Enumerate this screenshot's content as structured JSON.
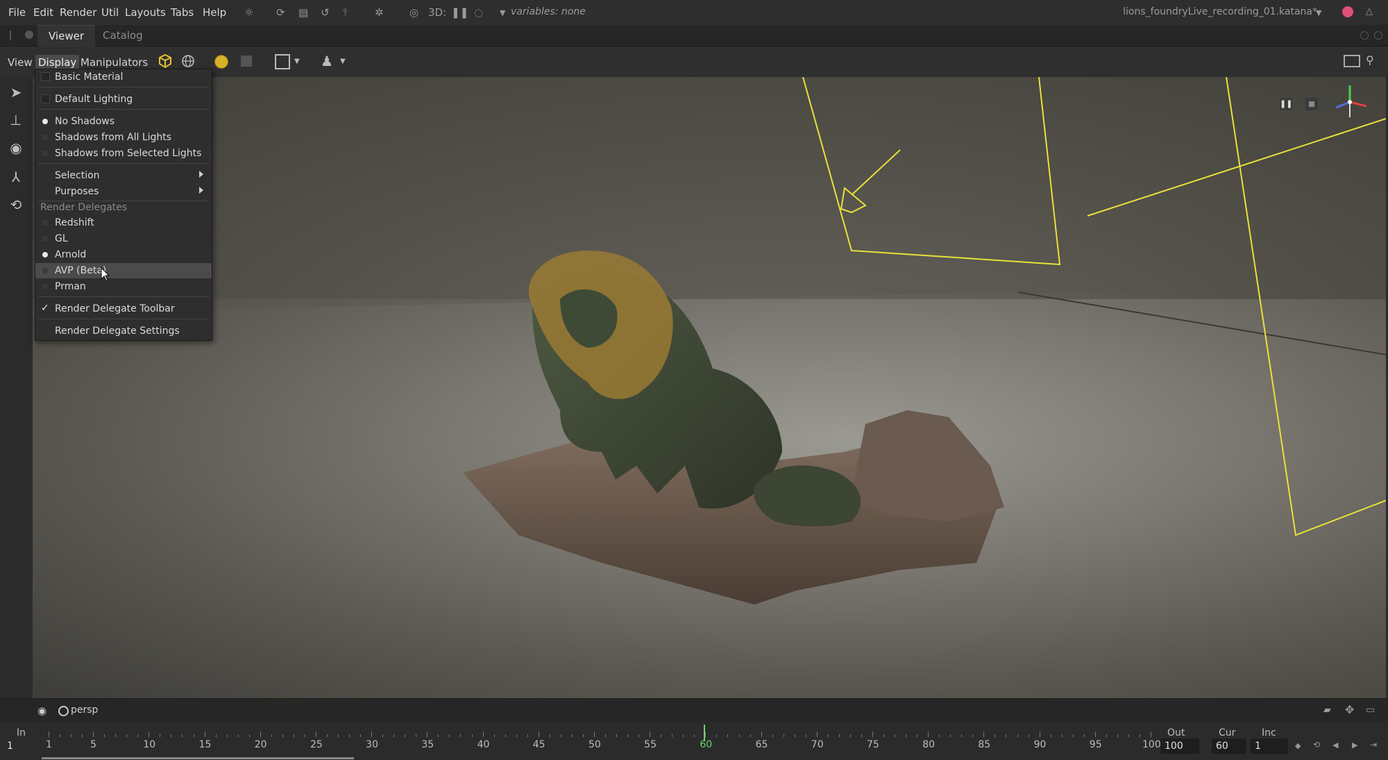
{
  "menubar": {
    "items": [
      "File",
      "Edit",
      "Render",
      "Util",
      "Layouts",
      "Tabs",
      "Help"
    ],
    "three_d_label": "3D:",
    "variables_label": "variables: none",
    "project_file": "lions_foundryLive_recording_01.katana*"
  },
  "tabs": [
    {
      "label": "Viewer"
    },
    {
      "label": "Catalog"
    }
  ],
  "viewer_toolbar": {
    "menus": [
      "View",
      "Display",
      "Manipulators"
    ]
  },
  "display_menu": {
    "basic_material": "Basic Material",
    "default_lighting": "Default Lighting",
    "shadows": [
      {
        "label": "No Shadows",
        "selected": true
      },
      {
        "label": "Shadows from All Lights",
        "selected": false
      },
      {
        "label": "Shadows from Selected Lights",
        "selected": false
      }
    ],
    "selection": "Selection",
    "purposes": "Purposes",
    "render_delegates_header": "Render Delegates",
    "delegates": [
      {
        "label": "Redshift",
        "selected": false
      },
      {
        "label": "GL",
        "selected": false
      },
      {
        "label": "Arnold",
        "selected": true
      },
      {
        "label": "AVP (Beta)",
        "selected": false,
        "highlighted": true
      },
      {
        "label": "Prman",
        "selected": false
      }
    ],
    "render_delegate_toolbar": "Render Delegate Toolbar",
    "render_delegate_toolbar_checked": true,
    "render_delegate_settings": "Render Delegate Settings"
  },
  "viewport": {
    "camera": "persp"
  },
  "timeline": {
    "in_label": "In",
    "in_value": "1",
    "out_label": "Out",
    "out_value": "100",
    "cur_label": "Cur",
    "cur_value": "60",
    "inc_label": "Inc",
    "inc_value": "1",
    "ticks": [
      "1",
      "5",
      "10",
      "15",
      "20",
      "25",
      "30",
      "35",
      "40",
      "45",
      "50",
      "55",
      "60",
      "65",
      "70",
      "75",
      "80",
      "85",
      "90",
      "95",
      "100"
    ],
    "current_frame": 60
  },
  "colors": {
    "accent_yellow": "#e8e23a",
    "current_frame": "#6bd46b",
    "record": "#e0507a"
  }
}
